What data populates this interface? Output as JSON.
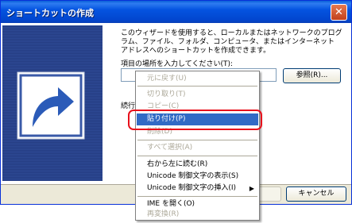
{
  "window": {
    "title": "ショートカットの作成",
    "close_glyph": "✕"
  },
  "wizard": {
    "description": "このウィザードを使用すると、ローカルまたはネットワークのプログラム、ファイル、フォルダ、コンピュータ、またはインターネット アドレスへのショートカットを作成できます。",
    "location_label": "項目の場所を入力してください(T):",
    "location_value": "",
    "browse_button": "参照(R)...",
    "continue_label": "続行",
    "next_button": "",
    "cancel_button": "キャンセル"
  },
  "context_menu": {
    "items": [
      {
        "label": "元に戻す(U)",
        "state": "disabled"
      },
      {
        "label": "切り取り(T)",
        "state": "disabled"
      },
      {
        "label": "コピー(C)",
        "state": "disabled"
      },
      {
        "label": "貼り付け(P)",
        "state": "selected"
      },
      {
        "label": "削除(D)",
        "state": "disabled"
      },
      {
        "label": "すべて選択(A)",
        "state": "disabled"
      },
      {
        "label": "右から左に読む(R)",
        "state": "enabled"
      },
      {
        "label": "Unicode 制御文字の表示(S)",
        "state": "enabled"
      },
      {
        "label": "Unicode 制御文字の挿入(I)",
        "state": "enabled",
        "submenu_arrow": "▶"
      },
      {
        "label": "IME を開く(O)",
        "state": "enabled"
      },
      {
        "label": "再変換(R)",
        "state": "disabled"
      }
    ]
  },
  "colors": {
    "titlebar": "#0454e0",
    "selection": "#316ac5",
    "highlight_ring": "#e8101b",
    "disabled_text": "#aca899"
  },
  "icons": [
    "close-icon",
    "shortcut-arrow-icon",
    "submenu-arrow-icon"
  ]
}
